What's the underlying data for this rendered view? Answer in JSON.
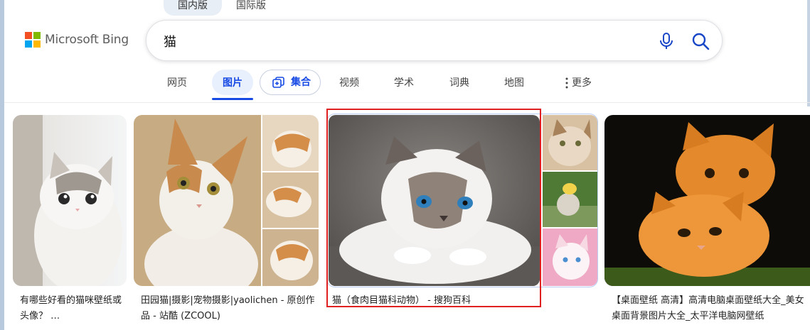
{
  "region_tabs": [
    {
      "label": "国内版",
      "active": true
    },
    {
      "label": "国际版",
      "active": false
    }
  ],
  "logo": {
    "text": "Microsoft Bing",
    "colors": [
      "#f25022",
      "#7fba00",
      "#00a4ef",
      "#ffb900"
    ]
  },
  "search": {
    "value": "猫",
    "mic_icon": "microphone-icon",
    "search_icon": "magnifier-icon"
  },
  "nav": {
    "items": [
      {
        "label": "网页"
      },
      {
        "label": "图片",
        "active": true
      },
      {
        "label": "集合",
        "icon": "collection-plus-icon"
      },
      {
        "label": "视频"
      },
      {
        "label": "学术"
      },
      {
        "label": "词典"
      },
      {
        "label": "地图"
      },
      {
        "label": "更多",
        "icon": "vertical-dots-icon"
      }
    ]
  },
  "results": [
    {
      "caption": "有哪些好看的猫咪壁纸或头像？ …"
    },
    {
      "caption": "田园猫|摄影|宠物摄影|yaolichen - 原创作品 - 站酷 (ZCOOL)"
    },
    {
      "caption": "猫（食肉目猫科动物） - 搜狗百科",
      "highlighted": true
    },
    {
      "caption": "【桌面壁纸 高清】高清电脑桌面壁纸大全_美女桌面背景图片大全_太平洋电脑网壁纸"
    }
  ],
  "colors": {
    "accent": "#174ae4",
    "highlight": "#e02020",
    "active_pill": "#e8effd"
  }
}
